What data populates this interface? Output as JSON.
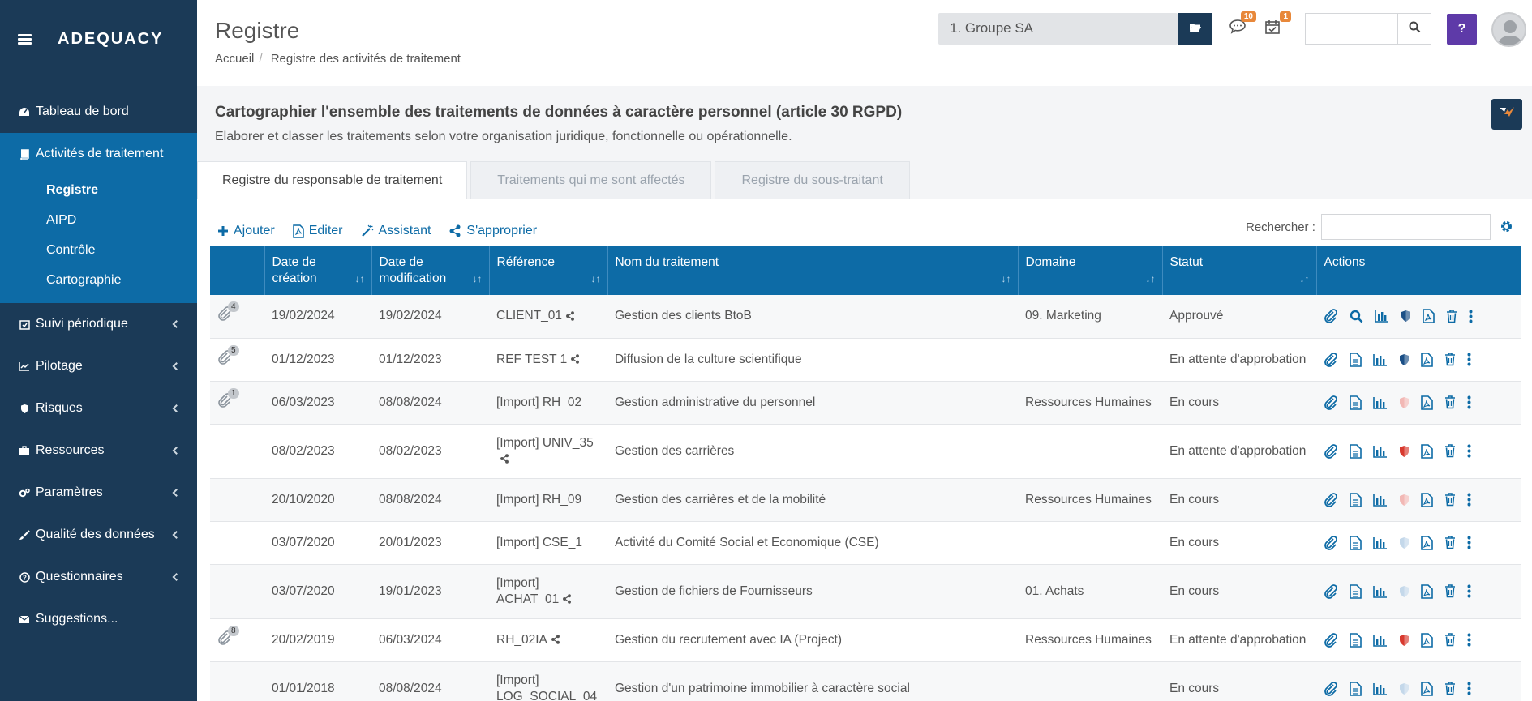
{
  "brand": "ADEQUACY",
  "sidebar": {
    "items_top": [
      {
        "label": "Tableau de bord",
        "icon": "dashboard-icon"
      }
    ],
    "active": {
      "label": "Activités de traitement",
      "icon": "book-icon"
    },
    "subitems": [
      "Registre",
      "AIPD",
      "Contrôle",
      "Cartographie"
    ],
    "items_bottom": [
      {
        "label": "Suivi périodique",
        "icon": "calendar-check-icon"
      },
      {
        "label": "Pilotage",
        "icon": "line-chart-icon"
      },
      {
        "label": "Risques",
        "icon": "shield-icon"
      },
      {
        "label": "Ressources",
        "icon": "briefcase-icon"
      },
      {
        "label": "Paramètres",
        "icon": "cogs-icon"
      },
      {
        "label": "Qualité des données",
        "icon": "paint-brush-icon"
      },
      {
        "label": "Questionnaires",
        "icon": "question-circle-icon"
      },
      {
        "label": "Suggestions...",
        "icon": "envelope-icon"
      }
    ]
  },
  "header": {
    "title": "Registre",
    "breadcrumb": [
      "Accueil",
      "Registre des activités de traitement"
    ],
    "org": "1. Groupe SA",
    "messages_count": "10",
    "tasks_count": "1",
    "help": "?"
  },
  "section": {
    "title": "Cartographier l'ensemble des traitements de données à caractère personnel (article 30 RGPD)",
    "subtitle": "Elaborer et classer les traitements selon votre organisation juridique, fonctionnelle ou opérationnelle."
  },
  "tabs": [
    "Registre du responsable de traitement",
    "Traitements qui me sont affectés",
    "Registre du sous-traitant"
  ],
  "toolbar": {
    "add": "Ajouter",
    "edit": "Editer",
    "assistant": "Assistant",
    "own": "S'approprier",
    "search_label": "Rechercher :"
  },
  "table": {
    "headers": {
      "created_1": "Date de",
      "created_2": "création",
      "modified_1": "Date de",
      "modified_2": "modification",
      "ref": "Référence",
      "name": "Nom du traitement",
      "domain": "Domaine",
      "status": "Statut",
      "actions": "Actions"
    },
    "rows": [
      {
        "clips": "4",
        "created": "19/02/2024",
        "modified": "19/02/2024",
        "ref": "CLIENT_01",
        "ref2": "",
        "shared": true,
        "name": "Gestion des clients BtoB",
        "domain": "09. Marketing",
        "status": "Approuvé",
        "view": "search",
        "shield": "#1b4f86"
      },
      {
        "clips": "5",
        "created": "01/12/2023",
        "modified": "01/12/2023",
        "ref": "REF TEST 1",
        "ref2": "",
        "shared": true,
        "name": "Diffusion de la culture scientifique",
        "domain": "",
        "status": "En attente d'approbation",
        "view": "doc",
        "shield": "#1b4f86"
      },
      {
        "clips": "1",
        "created": "06/03/2023",
        "modified": "08/08/2024",
        "ref": "[Import] RH_02",
        "ref2": "",
        "shared": false,
        "name": "Gestion administrative du personnel",
        "domain": "Ressources Humaines",
        "status": "En cours",
        "view": "doc",
        "shield": "#f2b8b5"
      },
      {
        "clips": "",
        "created": "08/02/2023",
        "modified": "08/02/2023",
        "ref": "[Import] UNIV_35",
        "ref2": "",
        "shared": true,
        "name": "Gestion des carrières",
        "domain": "",
        "status": "En attente d'approbation",
        "view": "doc",
        "shield": "#d83a2f"
      },
      {
        "clips": "",
        "created": "20/10/2020",
        "modified": "08/08/2024",
        "ref": "[Import] RH_09",
        "ref2": "",
        "shared": false,
        "name": "Gestion des carrières et de la mobilité",
        "domain": "Ressources Humaines",
        "status": "En cours",
        "view": "doc",
        "shield": "#f2b8b5"
      },
      {
        "clips": "",
        "created": "03/07/2020",
        "modified": "20/01/2023",
        "ref": "[Import] CSE_1",
        "ref2": "",
        "shared": false,
        "name": "Activité du Comité Social et Economique (CSE)",
        "domain": "",
        "status": "En cours",
        "view": "doc",
        "shield": "#c4d8ea"
      },
      {
        "clips": "",
        "created": "03/07/2020",
        "modified": "19/01/2023",
        "ref": "[Import]",
        "ref2": "ACHAT_01",
        "shared": true,
        "name": "Gestion de fichiers de Fournisseurs",
        "domain": "01. Achats",
        "status": "En cours",
        "view": "doc",
        "shield": "#c4d8ea"
      },
      {
        "clips": "8",
        "created": "20/02/2019",
        "modified": "06/03/2024",
        "ref": "RH_02IA",
        "ref2": "",
        "shared": true,
        "name": "Gestion du recrutement avec IA (Project)",
        "domain": "Ressources Humaines",
        "status": "En attente d'approbation",
        "view": "doc",
        "shield": "#d83a2f"
      },
      {
        "clips": "",
        "created": "01/01/2018",
        "modified": "08/08/2024",
        "ref": "[Import]",
        "ref2": "LOG_SOCIAL_04",
        "shared": false,
        "name": "Gestion d'un patrimoine immobilier à caractère social",
        "domain": "",
        "status": "En cours",
        "view": "doc",
        "shield": "#c4d8ea"
      }
    ]
  },
  "colors": {
    "sidebar": "#1b3a57",
    "accent": "#0d6ba6",
    "help": "#5e3aa8",
    "badge": "#e8883a"
  }
}
